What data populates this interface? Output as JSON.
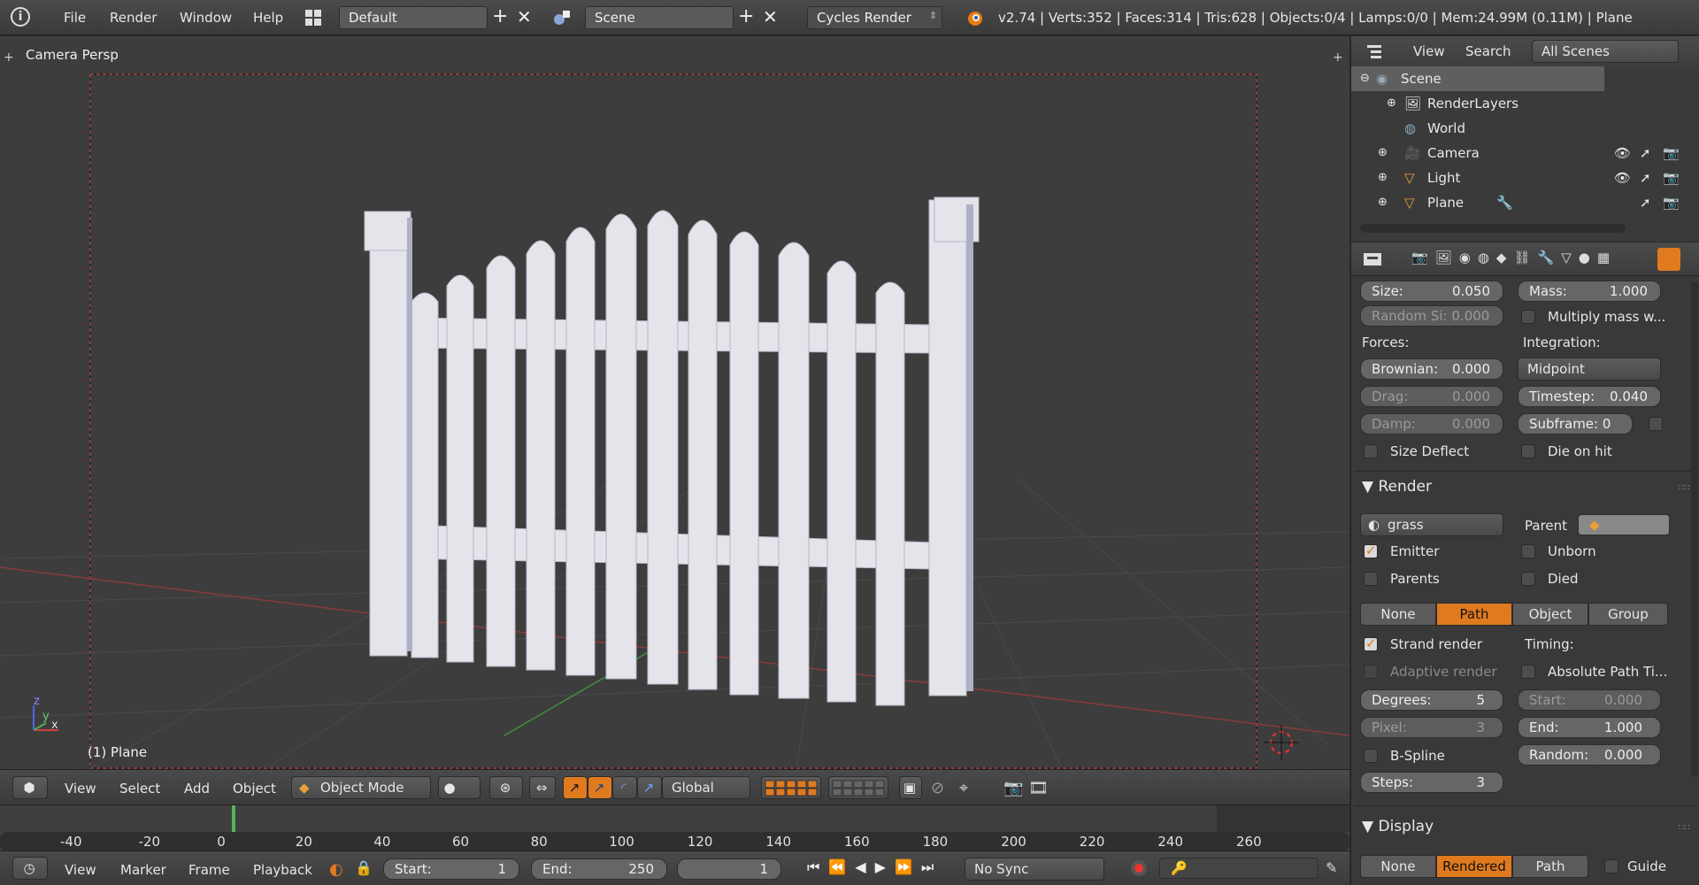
{
  "topbar": {
    "menus": [
      "File",
      "Render",
      "Window",
      "Help"
    ],
    "layout": "Default",
    "scene": "Scene",
    "engine": "Cycles Render",
    "stats": "v2.74 | Verts:352 | Faces:314 | Tris:628 | Objects:0/4 | Lamps:0/0 | Mem:24.99M (0.11M) | Plane"
  },
  "viewport": {
    "view_name": "Camera Persp",
    "object_label": "(1) Plane",
    "axis_x": "x",
    "axis_y": "y",
    "axis_z": "z"
  },
  "view3d_header": {
    "menus": [
      "View",
      "Select",
      "Add",
      "Object"
    ],
    "mode": "Object Mode",
    "orientation": "Global"
  },
  "timeline": {
    "ticks": [
      "-40",
      "-20",
      "0",
      "20",
      "40",
      "60",
      "80",
      "100",
      "120",
      "140",
      "160",
      "180",
      "200",
      "220",
      "240",
      "260"
    ],
    "current_frame": 1
  },
  "timeline_header": {
    "menus": [
      "View",
      "Marker",
      "Frame",
      "Playback"
    ],
    "start_label": "Start:",
    "start_value": "1",
    "end_label": "End:",
    "end_value": "250",
    "frame_value": "1",
    "sync": "No Sync"
  },
  "outliner": {
    "view": "View",
    "search": "Search",
    "filter": "All Scenes",
    "items": [
      "Scene",
      "RenderLayers",
      "World",
      "Camera",
      "Light",
      "Plane"
    ]
  },
  "properties": {
    "size_label": "Size:",
    "size_value": "0.050",
    "mass_label": "Mass:",
    "mass_value": "1.000",
    "random_size": "Random Si: 0.000",
    "multiply_mass": "Multiply mass w...",
    "forces_label": "Forces:",
    "integration_label": "Integration:",
    "brownian": "Brownian:",
    "brownian_value": "0.000",
    "integration_value": "Midpoint",
    "drag": "Drag:",
    "drag_value": "0.000",
    "timestep": "Timestep:",
    "timestep_value": "0.040",
    "damp": "Damp:",
    "damp_value": "0.000",
    "subframe": "Subframe: 0",
    "size_deflect": "Size Deflect",
    "die_on_hit": "Die on hit",
    "render_section": "Render",
    "material": "grass",
    "parent_label": "Parent",
    "emitter": "Emitter",
    "unborn": "Unborn",
    "parents": "Parents",
    "died": "Died",
    "render_as": [
      "None",
      "Path",
      "Object",
      "Group"
    ],
    "strand_render": "Strand render",
    "timing_label": "Timing:",
    "adaptive_render": "Adaptive render",
    "absolute_path": "Absolute Path Ti...",
    "degrees": "Degrees:",
    "degrees_value": "5",
    "start": "Start:",
    "start_value": "0.000",
    "pixel": "Pixel:",
    "pixel_value": "3",
    "end": "End:",
    "end_value": "1.000",
    "bspline": "B-Spline",
    "random": "Random:",
    "random_value": "0.000",
    "steps": "Steps:",
    "steps_value": "3",
    "display_section": "Display",
    "display_modes": [
      "None",
      "Rendered",
      "Path"
    ],
    "guide": "Guide"
  },
  "colors": {
    "accent": "#e07a1f",
    "viewport_bg": "#3d3d3d",
    "fence": "#e4e4ea"
  }
}
